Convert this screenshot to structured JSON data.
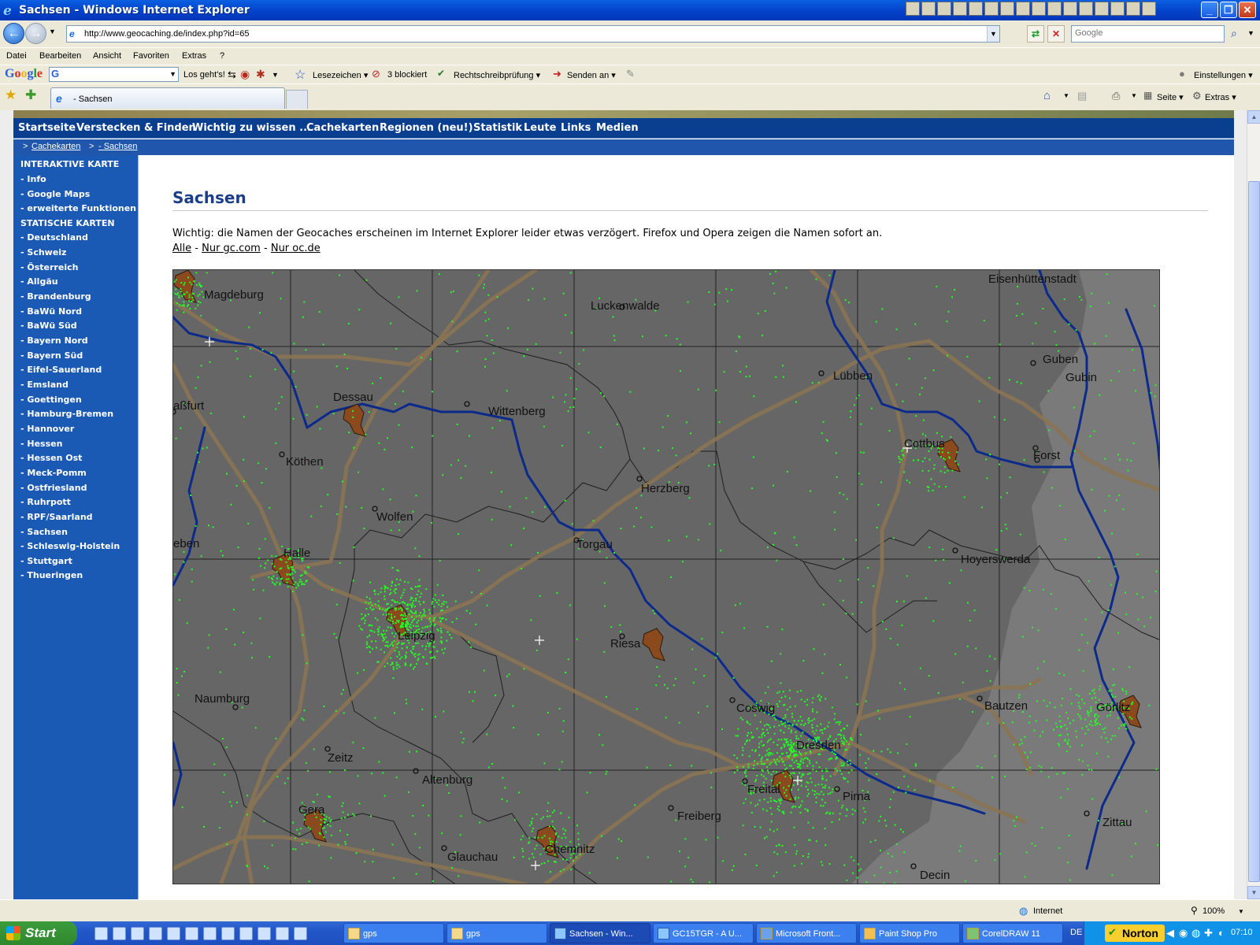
{
  "window": {
    "title": "Sachsen - Windows Internet Explorer"
  },
  "address": {
    "url": "http://www.geocaching.de/index.php?id=65",
    "search_placeholder": "Google"
  },
  "menu": [
    "Datei",
    "Bearbeiten",
    "Ansicht",
    "Favoriten",
    "Extras",
    "?"
  ],
  "google_toolbar": {
    "logo": "Google",
    "go": "Los geht's!",
    "bookmarks": "Lesezeichen",
    "blocked": "3 blockiert",
    "spellcheck": "Rechtschreibprüfung",
    "send": "Senden an",
    "settings": "Einstellungen"
  },
  "tabs": {
    "active_label": "- Sachsen",
    "page_cmd": "Seite",
    "tools_cmd": "Extras"
  },
  "site": {
    "topnav": [
      "Startseite",
      "Verstecken & Finden",
      "Wichtig zu wissen ...",
      "Cachekarten",
      "Regionen (neu!)",
      "Statistik",
      "Leute",
      "Links",
      "Medien"
    ],
    "breadcrumb": {
      "sep1": ">",
      "link1": "Cachekarten",
      "sep2": ">",
      "link2": "- Sachsen"
    },
    "sidebar": [
      {
        "label": "INTERAKTIVE KARTE",
        "head": true
      },
      {
        "label": "- Info"
      },
      {
        "label": "- Google Maps"
      },
      {
        "label": "- erweiterte Funktionen"
      },
      {
        "label": "STATISCHE KARTEN",
        "head": true
      },
      {
        "label": "- Deutschland"
      },
      {
        "label": "- Schweiz"
      },
      {
        "label": "- Österreich"
      },
      {
        "label": "- Allgäu"
      },
      {
        "label": "- Brandenburg"
      },
      {
        "label": "- BaWü Nord"
      },
      {
        "label": "- BaWü Süd"
      },
      {
        "label": "- Bayern Nord"
      },
      {
        "label": "- Bayern Süd"
      },
      {
        "label": "- Eifel-Sauerland"
      },
      {
        "label": "- Emsland"
      },
      {
        "label": "- Goettingen"
      },
      {
        "label": "- Hamburg-Bremen"
      },
      {
        "label": "- Hannover"
      },
      {
        "label": "- Hessen"
      },
      {
        "label": "- Hessen Ost"
      },
      {
        "label": "- Meck-Pomm"
      },
      {
        "label": "- Ostfriesland"
      },
      {
        "label": "- Ruhrpott"
      },
      {
        "label": "- RPF/Saarland"
      },
      {
        "label": "- Sachsen"
      },
      {
        "label": "- Schleswig-Holstein"
      },
      {
        "label": "- Stuttgart"
      },
      {
        "label": "- Thueringen"
      }
    ],
    "heading": "Sachsen",
    "note": "Wichtig: die Namen der Geocaches erscheinen im Internet Explorer leider etwas verzögert. Firefox und Opera zeigen die Namen sofort an.",
    "filter": {
      "all": "Alle",
      "sep1": "-",
      "gc": "Nur gc.com",
      "sep2": "-",
      "oc": "Nur oc.de"
    },
    "map_labels": [
      "Magdeburg",
      "Luckenwalde",
      "Eisenhüttenstadt",
      "Guben",
      "Gubin",
      "Lübben",
      "aßfurt",
      "Dessau",
      "Wittenberg",
      "Cottbus",
      "Forst",
      "Köthen",
      "Herzberg",
      "Wolfen",
      "eben",
      "Halle",
      "Torgau",
      "Hoyerswerda",
      "Leipzig",
      "Riesa",
      "Naumburg",
      "Coswig",
      "Bautzen",
      "Görlitz",
      "Zeitz",
      "Dresden",
      "Altenburg",
      "Freital",
      "Pirna",
      "Gera",
      "Freiberg",
      "Zittau",
      "Glauchau",
      "Chemnitz",
      "Decin"
    ],
    "colors": {
      "map_bg": "#666666",
      "border_grey_zone": "#7a7a7a",
      "road": "#8a7352",
      "river": "#0b2a8a",
      "cache_dot": "#22ff22",
      "city_area": "#8a4a1e",
      "nav_bg": "#0a3f8f",
      "sidebar_bg": "#1a5ab5",
      "heading": "#1b3f86"
    }
  },
  "status": {
    "zone": "Internet",
    "zoom": "100%"
  },
  "taskbar": {
    "start": "Start",
    "tasks": [
      "gps",
      "gps",
      "Sachsen - Win...",
      "GC15TGR - A U...",
      "Microsoft Front...",
      "Paint Shop Pro",
      "CorelDRAW 11"
    ],
    "lang": "DE",
    "norton": "Norton",
    "clock": "07:10"
  }
}
